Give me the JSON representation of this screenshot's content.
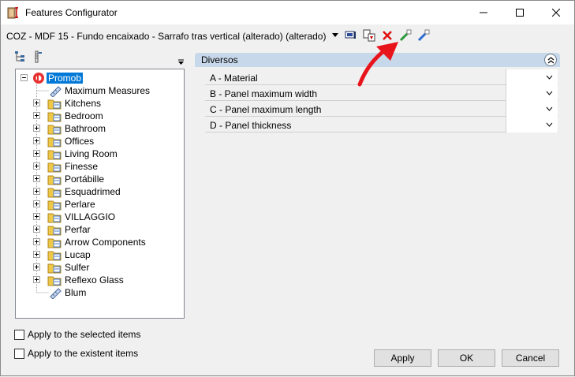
{
  "window": {
    "title": "Features Configurator"
  },
  "toolbar": {
    "configuration_combo_value": "COZ - MDF 15 - Fundo encaixado - Sarrafo tras vertical (alterado) (alterado)",
    "icons": [
      "screen-icon",
      "copy-icon",
      "delete-icon",
      "apply-green-icon",
      "apply-blue-icon"
    ]
  },
  "tree": {
    "root": {
      "label": "Promob",
      "icon": "promob-logo-icon"
    },
    "children": [
      {
        "label": "Maximum Measures",
        "icon": "ruler-icon",
        "expandable": false
      },
      {
        "label": "Kitchens",
        "icon": "folder-icon",
        "expandable": true
      },
      {
        "label": "Bedroom",
        "icon": "folder-icon",
        "expandable": true
      },
      {
        "label": "Bathroom",
        "icon": "folder-icon",
        "expandable": true
      },
      {
        "label": "Offices",
        "icon": "folder-icon",
        "expandable": true
      },
      {
        "label": "Living Room",
        "icon": "folder-icon",
        "expandable": true
      },
      {
        "label": "Finesse",
        "icon": "folder-icon",
        "expandable": true
      },
      {
        "label": "Portábille",
        "icon": "folder-icon",
        "expandable": true
      },
      {
        "label": "Esquadrimed",
        "icon": "folder-icon",
        "expandable": true
      },
      {
        "label": "Perlare",
        "icon": "folder-icon",
        "expandable": true
      },
      {
        "label": "VILLAGGIO",
        "icon": "folder-icon",
        "expandable": true
      },
      {
        "label": "Perfar",
        "icon": "folder-icon",
        "expandable": true
      },
      {
        "label": "Arrow Components",
        "icon": "folder-icon",
        "expandable": true
      },
      {
        "label": "Lucap",
        "icon": "folder-icon",
        "expandable": true
      },
      {
        "label": "Sulfer",
        "icon": "folder-icon",
        "expandable": true
      },
      {
        "label": "Reflexo Glass",
        "icon": "folder-icon",
        "expandable": true
      },
      {
        "label": "Blum",
        "icon": "ruler-icon",
        "expandable": false
      }
    ]
  },
  "properties": {
    "group_title": "Diversos",
    "rows": [
      {
        "label": "A - Material",
        "value": ""
      },
      {
        "label": "B - Panel maximum width",
        "value": ""
      },
      {
        "label": "C - Panel maximum length",
        "value": ""
      },
      {
        "label": "D - Panel thickness",
        "value": ""
      }
    ]
  },
  "options": {
    "apply_selected": "Apply to the selected items",
    "apply_existent": "Apply to the existent items"
  },
  "buttons": {
    "apply": "Apply",
    "ok": "OK",
    "cancel": "Cancel"
  },
  "colors": {
    "selection": "#0078d7",
    "group_header": "#c7d8ea",
    "annotation_arrow": "#e8141c"
  }
}
